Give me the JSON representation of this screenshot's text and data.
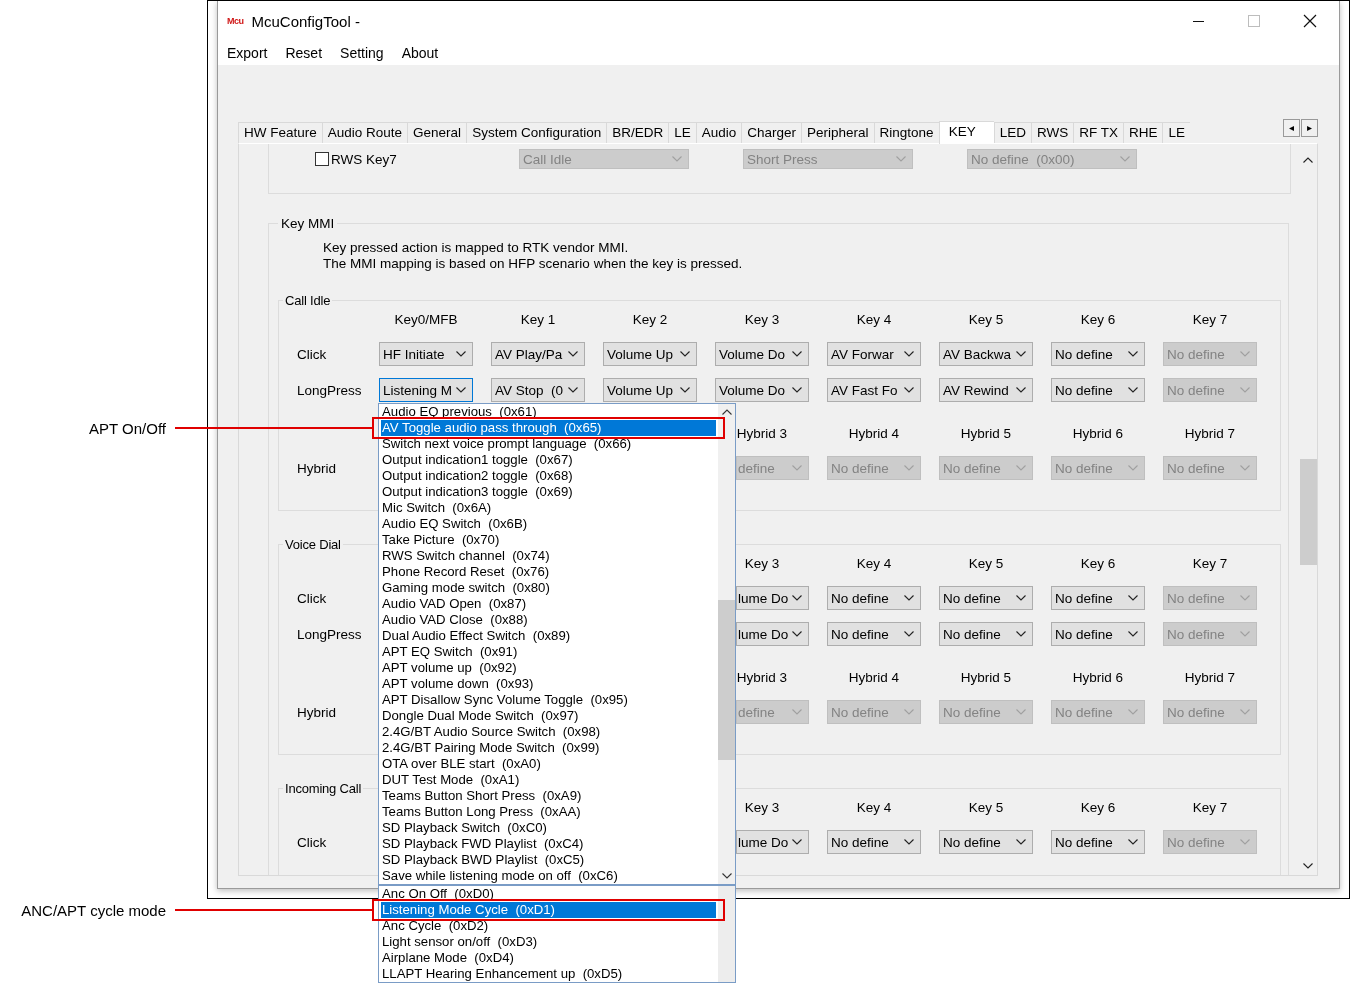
{
  "window": {
    "icon_text": "Mcu",
    "title": "McuConfigTool -"
  },
  "menu": [
    "Export",
    "Reset",
    "Setting",
    "About"
  ],
  "tabs": [
    {
      "label": "HW Feature",
      "selected": false
    },
    {
      "label": "Audio Route",
      "selected": false
    },
    {
      "label": "General",
      "selected": false
    },
    {
      "label": "System Configuration",
      "selected": false
    },
    {
      "label": "BR/EDR",
      "selected": false
    },
    {
      "label": "LE",
      "selected": false
    },
    {
      "label": "Audio",
      "selected": false
    },
    {
      "label": "Charger",
      "selected": false
    },
    {
      "label": "Peripheral",
      "selected": false
    },
    {
      "label": "Ringtone",
      "selected": false
    },
    {
      "label": "KEY",
      "selected": true
    },
    {
      "label": "LED",
      "selected": false
    },
    {
      "label": "RWS",
      "selected": false
    },
    {
      "label": "RF TX",
      "selected": false
    },
    {
      "label": "RHE",
      "selected": false
    },
    {
      "label": "LE",
      "selected": false
    }
  ],
  "tab_scroll": [
    "◂",
    "▸"
  ],
  "prev_row": {
    "checkbox": {
      "label": "RWS Key7",
      "checked": false
    },
    "combos": [
      {
        "text": "Call Idle",
        "disabled": true
      },
      {
        "text": "Short Press",
        "disabled": true
      },
      {
        "text": "No define  (0x00)",
        "disabled": true
      }
    ]
  },
  "key_mmi": {
    "title": "Key MMI",
    "description": [
      "Key pressed action is mapped to RTK vendor MMI.",
      "The MMI mapping is based on HFP scenario when the key is pressed."
    ],
    "sections": [
      {
        "title": "Call Idle",
        "rows": [
          {
            "kind": "header",
            "cells": [
              "Key0/MFB",
              "Key 1",
              "Key 2",
              "Key 3",
              "Key 4",
              "Key 5",
              "Key 6",
              "Key 7"
            ]
          },
          {
            "kind": "combos",
            "label": "Click",
            "cells": [
              {
                "text": "HF Initiate",
                "disabled": false
              },
              {
                "text": "AV Play/Pa",
                "disabled": false
              },
              {
                "text": "Volume Up",
                "disabled": false
              },
              {
                "text": "Volume Do",
                "disabled": false
              },
              {
                "text": "AV Forwar",
                "disabled": false
              },
              {
                "text": "AV Backwa",
                "disabled": false
              },
              {
                "text": "No define",
                "disabled": false
              },
              {
                "text": "No define",
                "disabled": true
              }
            ]
          },
          {
            "kind": "combos",
            "label": "LongPress",
            "cells": [
              {
                "text": "Listening M",
                "disabled": false,
                "open": true
              },
              {
                "text": "AV Stop  (0",
                "disabled": false
              },
              {
                "text": "Volume Up",
                "disabled": false
              },
              {
                "text": "Volume Do",
                "disabled": false
              },
              {
                "text": "AV Fast Fo",
                "disabled": false
              },
              {
                "text": "AV Rewind",
                "disabled": false
              },
              {
                "text": "No define",
                "disabled": false
              },
              {
                "text": "No define",
                "disabled": true
              }
            ]
          },
          {
            "kind": "header",
            "cells": [
              "Hybrid 3",
              "Hybrid 4",
              "Hybrid 5",
              "Hybrid 6",
              "Hybrid 7"
            ]
          },
          {
            "kind": "combos",
            "label": "Hybrid",
            "cells": [
              {
                "text": "define",
                "disabled": true,
                "kind": "partial"
              },
              {
                "text": "No define",
                "disabled": true,
                "kind": "full"
              },
              {
                "text": "No define",
                "disabled": true,
                "kind": "full"
              },
              {
                "text": "No define",
                "disabled": true,
                "kind": "full"
              },
              {
                "text": "No define",
                "disabled": true,
                "kind": "full"
              }
            ]
          }
        ]
      },
      {
        "title": "Voice Dial",
        "rows": [
          {
            "kind": "header",
            "cells": [
              "Key 3",
              "Key 4",
              "Key 5",
              "Key 6",
              "Key 7"
            ]
          },
          {
            "kind": "combos",
            "label": "Click",
            "cells": [
              {
                "text": "lume Do",
                "disabled": false,
                "kind": "partial"
              },
              {
                "text": "No define",
                "disabled": false,
                "kind": "full"
              },
              {
                "text": "No define",
                "disabled": false,
                "kind": "full"
              },
              {
                "text": "No define",
                "disabled": false,
                "kind": "full"
              },
              {
                "text": "No define",
                "disabled": true,
                "kind": "full"
              }
            ]
          },
          {
            "kind": "combos",
            "label": "LongPress",
            "cells": [
              {
                "text": "lume Do",
                "disabled": false,
                "kind": "partial"
              },
              {
                "text": "No define",
                "disabled": false,
                "kind": "full"
              },
              {
                "text": "No define",
                "disabled": false,
                "kind": "full"
              },
              {
                "text": "No define",
                "disabled": false,
                "kind": "full"
              },
              {
                "text": "No define",
                "disabled": true,
                "kind": "full"
              }
            ]
          },
          {
            "kind": "header",
            "cells": [
              "Hybrid 3",
              "Hybrid 4",
              "Hybrid 5",
              "Hybrid 6",
              "Hybrid 7"
            ]
          },
          {
            "kind": "combos",
            "label": "Hybrid",
            "cells": [
              {
                "text": "define",
                "disabled": true,
                "kind": "partial"
              },
              {
                "text": "No define",
                "disabled": true,
                "kind": "full"
              },
              {
                "text": "No define",
                "disabled": true,
                "kind": "full"
              },
              {
                "text": "No define",
                "disabled": true,
                "kind": "full"
              },
              {
                "text": "No define",
                "disabled": true,
                "kind": "full"
              }
            ]
          }
        ]
      },
      {
        "title": "Incoming Call",
        "rows": [
          {
            "kind": "header",
            "cells": [
              "Key 3",
              "Key 4",
              "Key 5",
              "Key 6",
              "Key 7"
            ]
          },
          {
            "kind": "combos",
            "label": "Click",
            "cells": [
              {
                "text": "lume Do",
                "disabled": false,
                "kind": "partial"
              },
              {
                "text": "No define",
                "disabled": false,
                "kind": "full"
              },
              {
                "text": "No define",
                "disabled": false,
                "kind": "full"
              },
              {
                "text": "No define",
                "disabled": false,
                "kind": "full"
              },
              {
                "text": "No define",
                "disabled": true,
                "kind": "full"
              }
            ]
          }
        ]
      }
    ]
  },
  "dropdown": {
    "lists": [
      {
        "items": [
          {
            "text": "Audio EQ previous  (0x61)",
            "selected": false
          },
          {
            "text": "AV Toggle audio pass through  (0x65)",
            "selected": true
          },
          {
            "text": "Switch next voice prompt language  (0x66)",
            "selected": false
          },
          {
            "text": "Output indication1 toggle  (0x67)",
            "selected": false
          },
          {
            "text": "Output indication2 toggle  (0x68)",
            "selected": false
          },
          {
            "text": "Output indication3 toggle  (0x69)",
            "selected": false
          },
          {
            "text": "Mic Switch  (0x6A)",
            "selected": false
          },
          {
            "text": "Audio EQ Switch  (0x6B)",
            "selected": false
          },
          {
            "text": "Take Picture  (0x70)",
            "selected": false
          },
          {
            "text": "RWS Switch channel  (0x74)",
            "selected": false
          },
          {
            "text": "Phone Record Reset  (0x76)",
            "selected": false
          },
          {
            "text": "Gaming mode switch  (0x80)",
            "selected": false
          },
          {
            "text": "Audio VAD Open  (0x87)",
            "selected": false
          },
          {
            "text": "Audio VAD Close  (0x88)",
            "selected": false
          },
          {
            "text": "Dual Audio Effect Switch  (0x89)",
            "selected": false
          },
          {
            "text": "APT EQ Switch  (0x91)",
            "selected": false
          },
          {
            "text": "APT volume up  (0x92)",
            "selected": false
          },
          {
            "text": "APT volume down  (0x93)",
            "selected": false
          },
          {
            "text": "APT Disallow Sync Volume Toggle  (0x95)",
            "selected": false
          },
          {
            "text": "Dongle Dual Mode Switch  (0x97)",
            "selected": false
          },
          {
            "text": "2.4G/BT Audio Source Switch  (0x98)",
            "selected": false
          },
          {
            "text": "2.4G/BT Pairing Mode Switch  (0x99)",
            "selected": false
          },
          {
            "text": "OTA over BLE start  (0xA0)",
            "selected": false
          },
          {
            "text": "DUT Test Mode  (0xA1)",
            "selected": false
          },
          {
            "text": "Teams Button Short Press  (0xA9)",
            "selected": false
          },
          {
            "text": "Teams Button Long Press  (0xAA)",
            "selected": false
          },
          {
            "text": "SD Playback Switch  (0xC0)",
            "selected": false
          },
          {
            "text": "SD Playback FWD Playlist  (0xC4)",
            "selected": false
          },
          {
            "text": "SD Playback BWD Playlist  (0xC5)",
            "selected": false
          },
          {
            "text": "Save while listening mode on off  (0xC6)",
            "selected": false
          }
        ]
      },
      {
        "items": [
          {
            "text": "Anc On Off  (0xD0)",
            "selected": false
          },
          {
            "text": "Listening Mode Cycle  (0xD1)",
            "selected": true
          },
          {
            "text": "Anc Cycle  (0xD2)",
            "selected": false
          },
          {
            "text": "Light sensor on/off  (0xD3)",
            "selected": false
          },
          {
            "text": "Airplane Mode  (0xD4)",
            "selected": false
          },
          {
            "text": "LLAPT Hearing Enhancement up  (0xD5)",
            "selected": false
          }
        ]
      }
    ]
  },
  "annotations": [
    {
      "label": "APT On/Off"
    },
    {
      "label": "ANC/APT cycle mode"
    }
  ]
}
